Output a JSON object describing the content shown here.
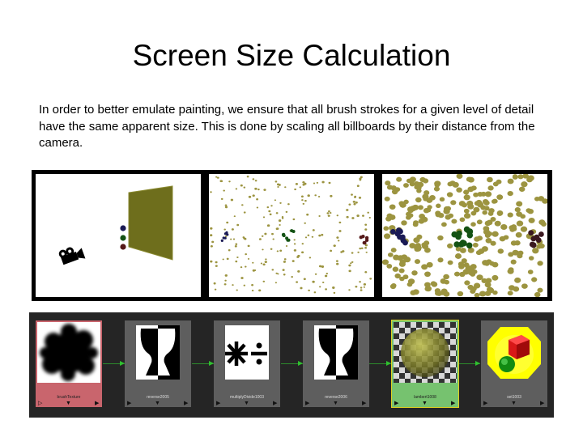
{
  "slide": {
    "title": "Screen Size Calculation",
    "body": "In order to better emulate painting, we ensure that all brush strokes for a given level of detail have the same apparent size.  This is done by scaling all billboards by their distance from the camera."
  },
  "viewports": [
    {
      "name": "camera-overview",
      "colors": {
        "plane": "#6e6e1c",
        "sphere_blue": "#1a1a55",
        "sphere_green": "#145214",
        "sphere_red": "#551818"
      }
    },
    {
      "name": "sparse-billboards",
      "colors": {
        "stroke": "#9c9440"
      }
    },
    {
      "name": "dense-billboards",
      "colors": {
        "stroke": "#9c9440"
      }
    }
  ],
  "node_editor": {
    "nodes": [
      {
        "label": "brushTexture",
        "state": "selected",
        "color": "#c9656d"
      },
      {
        "label": "reverse2005",
        "state": "normal"
      },
      {
        "label": "multiplyDivide1003",
        "state": "normal"
      },
      {
        "label": "reverse2006",
        "state": "normal"
      },
      {
        "label": "lambert1008",
        "state": "active",
        "color": "#76c26f"
      },
      {
        "label": "set1003",
        "state": "normal"
      }
    ],
    "controls": {
      "left": "▶",
      "center": "▼",
      "right": "▶"
    },
    "first_controls": {
      "left": "▷",
      "center": "▼",
      "right": "▶"
    },
    "connection_color": "#2fc02f"
  }
}
